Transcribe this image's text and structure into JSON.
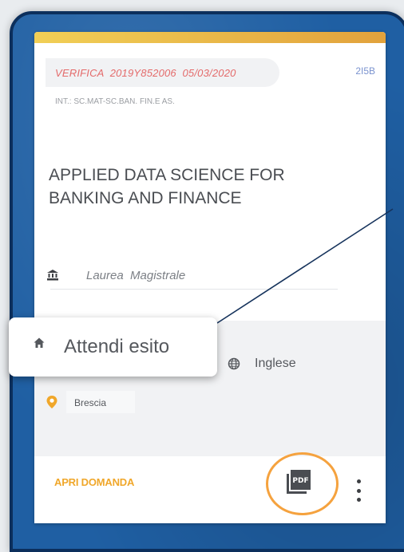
{
  "card": {
    "verification_label": "VERIFICA  2019Y852006  05/03/2020",
    "code": "2I5B",
    "department": "INT.: SC.MAT-SC.BAN. FIN.E AS.",
    "title": "APPLIED DATA SCIENCE FOR BANKING AND FINANCE",
    "degree_type": "Laurea  Magistrale",
    "language": "Inglese",
    "city": "Brescia",
    "open_button_label": "APRI DOMANDA",
    "pdf_icon_text": "PDF"
  },
  "tooltip": {
    "status_text": "Attendi esito"
  },
  "colors": {
    "accent_orange": "#f0a72a",
    "verification_red": "#e46b6b",
    "code_blue": "#7b93cf",
    "frame_blue": "#1f5fa3",
    "highlight_ring": "#f5a23e"
  },
  "icons": {
    "degree": "institution-icon",
    "language": "globe-icon",
    "city": "location-pin-icon",
    "status": "home-icon",
    "pdf": "pdf-icon",
    "menu": "more-vert-icon"
  }
}
